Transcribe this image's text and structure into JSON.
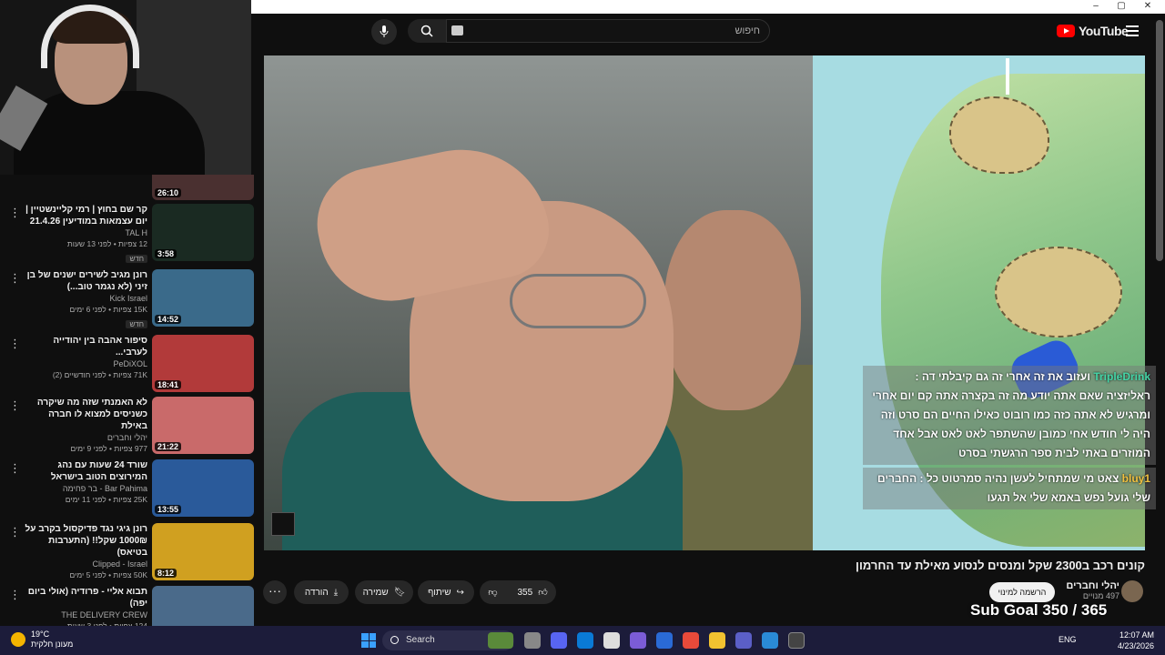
{
  "search": {
    "placeholder": "חיפוש"
  },
  "logo": {
    "text": "YouTube",
    "region": "IL"
  },
  "video": {
    "title": "קונים רכב ב2300 שקל ומנסים לנסוע מאילת עד החרמון",
    "likes": "355",
    "share": "שיתוף",
    "save": "שמירה",
    "download": "הורדה",
    "more": "···"
  },
  "channel": {
    "name": "יהלי וחברים",
    "subs": "497 מנויים",
    "subscribe": "הרשמה למינוי"
  },
  "sub_goal": "Sub Goal 350 / 365",
  "chat": [
    {
      "user": "TripleDrink",
      "text": "ועזוב את זה אחרי זה גם קיבלתי דה : ראליזציה שאם אתה יודע מה זה בקצרה אתה קם יום אחרי ומרגיש לא אתה כזה כמו רובוט כאילו החיים הם סרט וזה היה לי חודש אחי כמובן שהשתפר לאט לאט אבל אחד המוזרים באתי לבית ספר הרגשתי בסרט"
    },
    {
      "user": "bluy1",
      "text": "צאט מי שמתחיל לעשן נהיה סמרטוט כל : החברים שלי גועל נפש באמא שלי אל תגעו"
    }
  ],
  "sidebar": [
    {
      "title": "קר שם בחוץ | רמי קליינשטיין | יום עצמאות במודיעין 21.4.26",
      "channel": "TAL H",
      "meta": "12 צפיות • לפני 13 שעות",
      "badge": "חדש",
      "duration": "3:58",
      "color": "#1a2a22"
    },
    {
      "title": "רונן מגיב לשירים ישנים של בן זיני (לא נגמר טוב...)",
      "channel": "Kick Israel",
      "meta": "15K צפיות • לפני 6 ימים",
      "badge": "חדש",
      "duration": "14:52",
      "color": "#3a6a8a"
    },
    {
      "title": "סיפור אהבה בין יהודייה לערבי...",
      "channel": "PeDiXOL",
      "meta": "71K צפיות • לפני חודשיים (2)",
      "badge": "",
      "duration": "18:41",
      "color": "#b23a3a"
    },
    {
      "title": "לא האמנתי שזה מה שיקרה כשניסים למצוא לו חברה באילת",
      "channel": "יהלי וחברים",
      "meta": "977 צפיות • לפני 9 ימים",
      "badge": "",
      "duration": "21:22",
      "color": "#c96a6a"
    },
    {
      "title": "שורד 24 שעות עם נהג המירוצים הטוב בישראל",
      "channel": "Bar Pahima - בר פחימה",
      "meta": "25K צפיות • לפני 11 ימים",
      "badge": "",
      "duration": "13:55",
      "color": "#2a5a9a"
    },
    {
      "title": "רונן גיגי נגד פדיקסול בקרב על 1000₪ שקל!! (התערבות בטיאס)",
      "channel": "Clipped - Israel",
      "meta": "50K צפיות • לפני 5 ימים",
      "badge": "",
      "duration": "8:12",
      "color": "#d0a020"
    },
    {
      "title": "תבוא אליי - פרודיה (אולי ביום יפה)",
      "channel": "THE DELIVERY CREW",
      "meta": "124 צפיות • לפני 3 שעות",
      "badge": "",
      "duration": "",
      "color": "#4a6a8a"
    }
  ],
  "first_duration": "26:10",
  "taskbar": {
    "temp": "19°C",
    "weather": "מעונן חלקית",
    "search": "Search",
    "lang": "ENG",
    "time": "12:07 AM",
    "date": "4/23/2026"
  },
  "colors": {
    "accent": "#ff0000",
    "bg": "#0f0f0f"
  }
}
